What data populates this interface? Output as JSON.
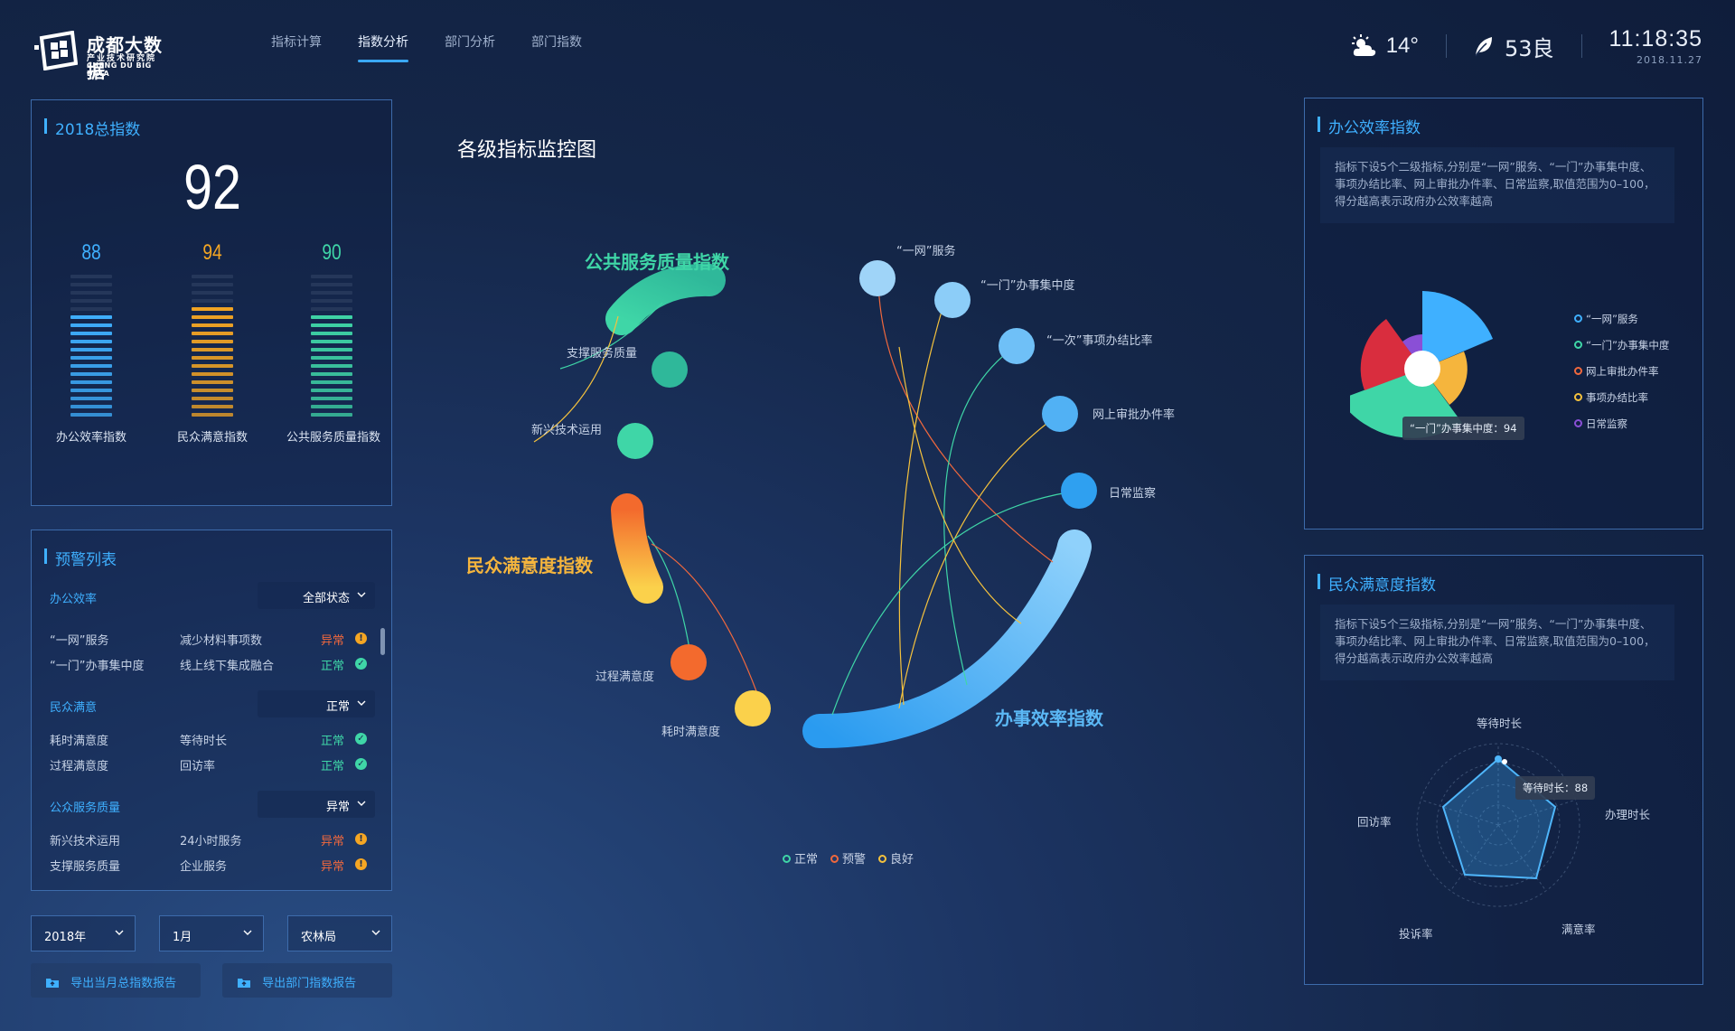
{
  "header": {
    "logo_cn": "成都大数据",
    "logo_sub": "产业技术研究院",
    "logo_en": "CHENG DU BIG DATA",
    "nav": [
      "指标计算",
      "指数分析",
      "部门分析",
      "部门指数"
    ],
    "active_nav": "指数分析",
    "weather": {
      "icon": "partly-cloudy-icon",
      "temp": "14°"
    },
    "aqi": {
      "icon": "leaf-icon",
      "value": "53良"
    },
    "time": "11:18:35",
    "date": "2018.11.27"
  },
  "total": {
    "title": "2018总指数",
    "value": "92",
    "bars": [
      {
        "label": "办公效率指数",
        "value": "88",
        "color": "#3fb0ff"
      },
      {
        "label": "民众满意指数",
        "value": "94",
        "color": "#f5a623"
      },
      {
        "label": "公共服务质量指数",
        "value": "90",
        "color": "#3fd6a7"
      }
    ]
  },
  "warnings": {
    "title": "预警列表",
    "groups": [
      {
        "name": "办公效率",
        "status": "全部状态",
        "rows": [
          {
            "a": "“一网”服务",
            "b": "减少材料事项数",
            "s": "异常"
          },
          {
            "a": "“一门”办事集中度",
            "b": "线上线下集成融合",
            "s": "正常"
          }
        ]
      },
      {
        "name": "民众满意",
        "status": "正常",
        "rows": [
          {
            "a": "耗时满意度",
            "b": "等待时长",
            "s": "正常"
          },
          {
            "a": "过程满意度",
            "b": "回访率",
            "s": "正常"
          }
        ]
      },
      {
        "name": "公众服务质量",
        "status": "异常",
        "rows": [
          {
            "a": "新兴技术运用",
            "b": "24小时服务",
            "s": "异常"
          },
          {
            "a": "支撑服务质量",
            "b": "企业服务",
            "s": "异常"
          }
        ]
      }
    ]
  },
  "filters": {
    "year": "2018年",
    "month": "1月",
    "dept": "农林局"
  },
  "buttons": {
    "export_month": "导出当月总指数报告",
    "export_dept": "导出部门指数报告"
  },
  "center": {
    "title": "各级指标监控图",
    "groups": {
      "public": "公共服务质量指数",
      "citizen": "民众满意度指数",
      "office": "办事效率指数"
    },
    "nodes": {
      "support": "支撑服务质量",
      "tech": "新兴技术运用",
      "process": "过程满意度",
      "time": "耗时满意度",
      "n1": "“一网”服务",
      "n2": "“一门”办事集中度",
      "n3": "“一次”事项办结比率",
      "n4": "网上审批办件率",
      "n5": "日常监察"
    },
    "legend": [
      "正常",
      "预警",
      "良好"
    ],
    "colors": {
      "normal": "#3fd6a7",
      "warn": "#f0683d",
      "good": "#f5c23d"
    }
  },
  "office": {
    "title": "办公效率指数",
    "desc": "指标下设5个二级指标,分别是“一网”服务、“一门”办事集中度、事项办结比率、网上审批办件率、日常监察,取值范围为0–100，得分越高表示政府办公效率越高",
    "legend": [
      "“一网”服务",
      "“一门”办事集中度",
      "网上审批办件率",
      "事项办结比率",
      "日常监察"
    ],
    "legend_colors": [
      "#3fb0ff",
      "#3fd6a7",
      "#f0683d",
      "#f5c23d",
      "#8a4fd6"
    ],
    "tooltip": "“一门”办事集中度：94"
  },
  "citizen": {
    "title": "民众满意度指数",
    "desc": "指标下设5个三级指标,分别是“一网”服务、“一门”办事集中度、事项办结比率、网上审批办件率、日常监察,取值范围为0–100，得分越高表示政府办公效率越高",
    "radar_labels": [
      "等待时长",
      "办理时长",
      "满意率",
      "投诉率",
      "回访率"
    ],
    "tooltip": "等待时长：88"
  }
}
